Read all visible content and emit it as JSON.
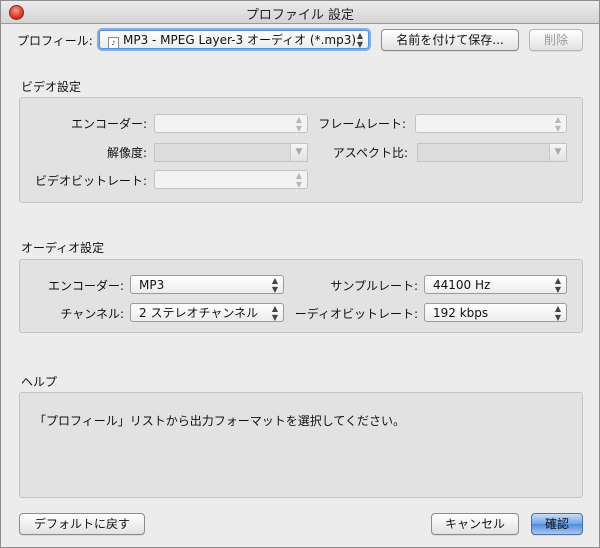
{
  "window": {
    "title": "プロファイル 設定"
  },
  "profile": {
    "label": "プロフィール:",
    "value": "MP3 - MPEG Layer-3 オーディオ (*.mp3)",
    "save_button": "名前を付けて保存...",
    "delete_button": "削除"
  },
  "video": {
    "section_title": "ビデオ設定",
    "encoder_label": "エンコーダー:",
    "resolution_label": "解像度:",
    "bitrate_label": "ビデオビットレート:",
    "framerate_label": "フレームレート:",
    "aspect_label": "アスペクト比:"
  },
  "audio": {
    "section_title": "オーディオ設定",
    "encoder_label": "エンコーダー:",
    "encoder_value": "MP3",
    "channel_label": "チャンネル:",
    "channel_value": "2 ステレオチャンネル",
    "samplerate_label": "サンプルレート:",
    "samplerate_value": "44100 Hz",
    "bitrate_label": "ーディオビットレート:",
    "bitrate_value": "192 kbps"
  },
  "help": {
    "section_title": "ヘルプ",
    "text": "「プロフィール」リストから出力フォーマットを選択してください。"
  },
  "footer": {
    "default_button": "デフォルトに戻す",
    "cancel_button": "キャンセル",
    "ok_button": "確認"
  },
  "icons": {
    "updown": "▲▼",
    "down": "▼"
  }
}
